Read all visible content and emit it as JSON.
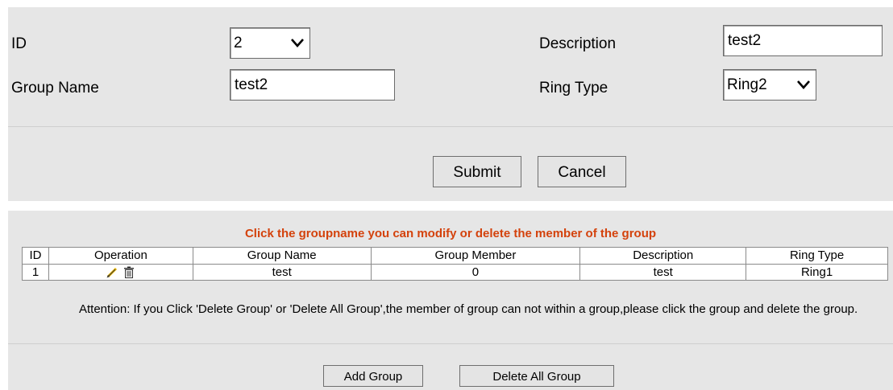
{
  "form": {
    "id_label": "ID",
    "id_value": "2",
    "group_name_label": "Group Name",
    "group_name_value": "test2",
    "description_label": "Description",
    "description_value": "test2",
    "ring_type_label": "Ring Type",
    "ring_type_value": "Ring2",
    "submit_label": "Submit",
    "cancel_label": "Cancel"
  },
  "groups": {
    "hint": "Click the groupname you can modify or delete the member of the group",
    "columns": [
      "ID",
      "Operation",
      "Group Name",
      "Group Member",
      "Description",
      "Ring Type"
    ],
    "rows": [
      {
        "id": "1",
        "group_name": "test",
        "group_member": "0",
        "description": "test",
        "ring_type": "Ring1"
      }
    ],
    "operation_icons": [
      "pencil-icon",
      "trash-icon"
    ],
    "attention": "Attention: If you Click 'Delete Group' or 'Delete All Group',the member of group can not within a group,please click the group and delete the group.",
    "add_group_label": "Add Group",
    "delete_all_label": "Delete All Group"
  },
  "colors": {
    "panel_bg": "#e6e6e6",
    "hint_text": "#d4420c",
    "pencil_tip": "#e8b400"
  }
}
